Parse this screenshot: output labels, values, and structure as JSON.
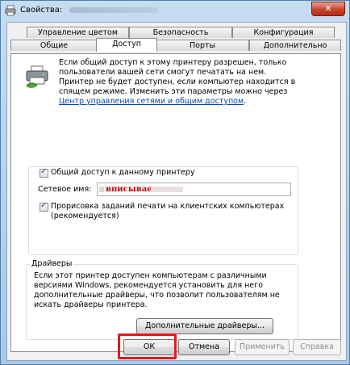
{
  "window": {
    "title_prefix": "Свойства:",
    "close_glyph": "✕"
  },
  "tabs_back": [
    {
      "label": "Управление цветом"
    },
    {
      "label": "Безопасность"
    },
    {
      "label": "Конфигурация"
    }
  ],
  "tabs_front": [
    {
      "label": "Общие"
    },
    {
      "label": "Доступ"
    },
    {
      "label": "Порты"
    },
    {
      "label": "Дополнительно"
    }
  ],
  "sharing": {
    "info_text": "Если общий доступ к этому принтеру разрешен, только пользователи вашей сети смогут печатать на нем. Принтер не будет доступен, если компьютер находится в спящем режиме. Изменить эти параметры можно через ",
    "info_link": "Центр управления сетями и общим доступом",
    "info_end": ".",
    "share_checkbox_label": "Общий доступ к данному принтеру",
    "share_checked": true,
    "share_name_label": "Сетевое имя:",
    "share_name_value": "вписываем",
    "render_checkbox_label": "Прорисовка заданий печати на клиентских компьютерах (рекомендуется)",
    "render_checked": true
  },
  "drivers": {
    "title": "Драйверы",
    "text": "Если этот принтер доступен компьютерам с различными версиями Windows, рекомендуется установить для него дополнительные драйверы, что позволит пользователям не искать драйверы принтера.",
    "button_label": "Дополнительные драйверы..."
  },
  "footer": {
    "ok_label": "ОК",
    "cancel_label": "Отмена",
    "apply_label": "Применить",
    "help_label": "Справка",
    "apply_enabled": false,
    "help_enabled": false
  },
  "colors": {
    "highlight": "#e2191d",
    "link": "#0645ad",
    "share_name_text": "#c00000"
  },
  "icons": [
    "printer-window-icon",
    "shared-printer-icon",
    "close-icon",
    "checkmark-icon"
  ]
}
